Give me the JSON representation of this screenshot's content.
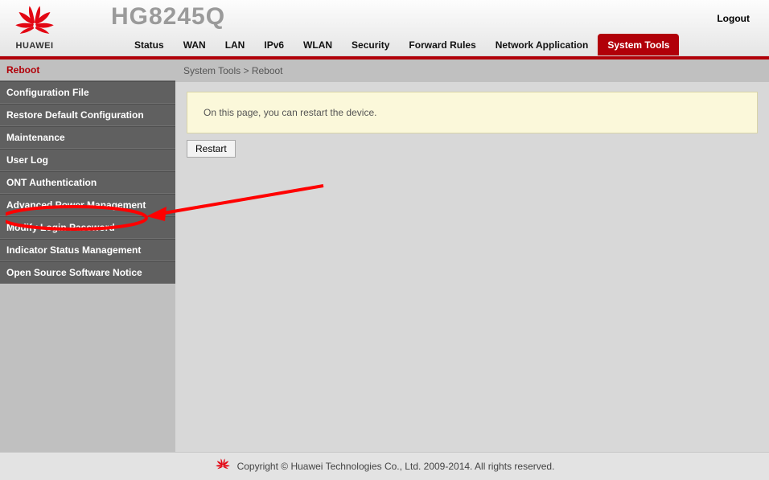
{
  "header": {
    "brand": "HUAWEI",
    "model": "HG8245Q",
    "logout": "Logout"
  },
  "topnav": {
    "items": [
      {
        "label": "Status",
        "active": false
      },
      {
        "label": "WAN",
        "active": false
      },
      {
        "label": "LAN",
        "active": false
      },
      {
        "label": "IPv6",
        "active": false
      },
      {
        "label": "WLAN",
        "active": false
      },
      {
        "label": "Security",
        "active": false
      },
      {
        "label": "Forward Rules",
        "active": false
      },
      {
        "label": "Network Application",
        "active": false
      },
      {
        "label": "System Tools",
        "active": true
      }
    ]
  },
  "sidebar": {
    "items": [
      {
        "label": "Reboot",
        "active": true
      },
      {
        "label": "Configuration File",
        "active": false
      },
      {
        "label": "Restore Default Configuration",
        "active": false
      },
      {
        "label": "Maintenance",
        "active": false
      },
      {
        "label": "User Log",
        "active": false
      },
      {
        "label": "ONT Authentication",
        "active": false
      },
      {
        "label": "Advanced Power Management",
        "active": false
      },
      {
        "label": "Modify Login Password",
        "active": false
      },
      {
        "label": "Indicator Status Management",
        "active": false
      },
      {
        "label": "Open Source Software Notice",
        "active": false
      }
    ]
  },
  "main": {
    "breadcrumb": "System Tools > Reboot",
    "info_text": "On this page, you can restart the device.",
    "restart_label": "Restart"
  },
  "footer": {
    "copyright": "Copyright © Huawei Technologies Co., Ltd. 2009-2014. All rights reserved."
  },
  "annotation": {
    "target": "Modify Login Password",
    "color": "#ff0000"
  }
}
